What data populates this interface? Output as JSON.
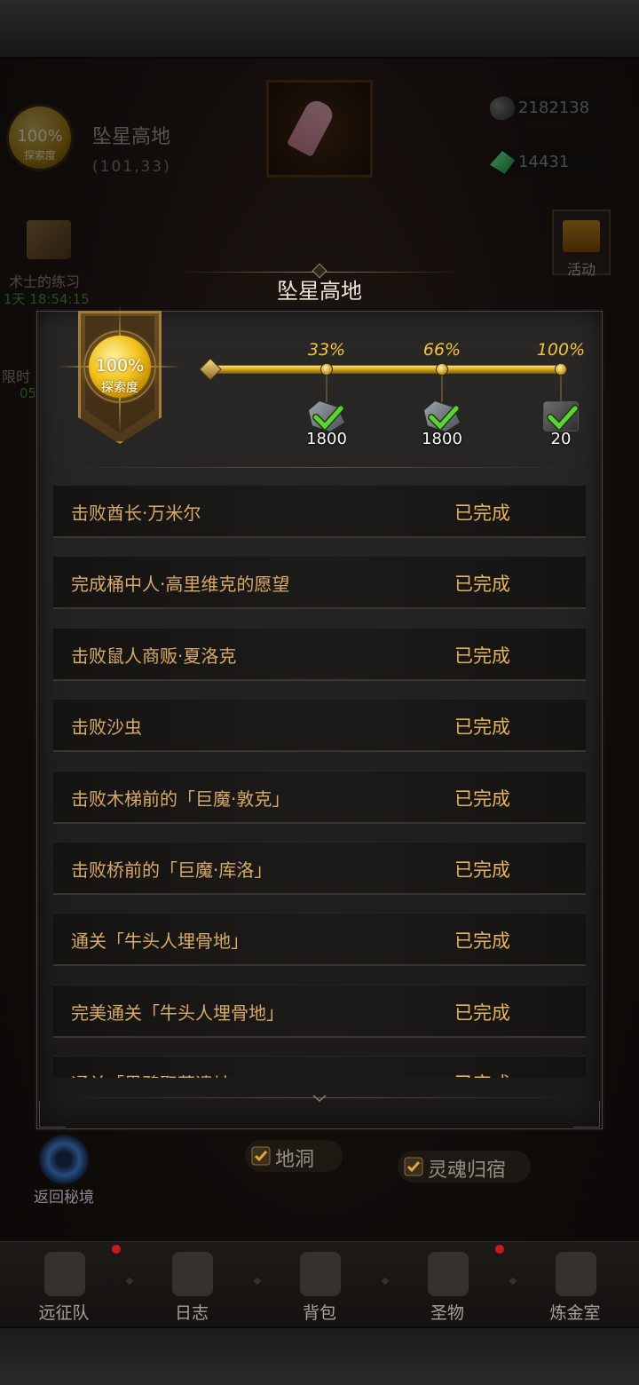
{
  "location": {
    "title": "坠星高地",
    "coords": "(101,33)",
    "badge_pct": "100%",
    "badge_label": "探索度"
  },
  "resources": {
    "stone_icon": "stone-icon",
    "stone": "2182138",
    "gem_icon": "gem-icon",
    "gem": "14431"
  },
  "side": {
    "crate_label": "术士的练习",
    "crate_timer": "1天 18:54:15",
    "limited_label": "限时",
    "limited_timer": "05",
    "gift_label": "活动"
  },
  "modal": {
    "title": "坠星高地",
    "explore_pct": "100%",
    "explore_label": "探索度",
    "progress": 1.0,
    "milestones": [
      {
        "pct": "33%",
        "reward": "crystal-icon",
        "qty": "1800",
        "claimed": true
      },
      {
        "pct": "66%",
        "reward": "crystal-icon",
        "qty": "1800",
        "claimed": true
      },
      {
        "pct": "100%",
        "reward": "ore-icon",
        "qty": "20",
        "claimed": true
      }
    ],
    "tasks": [
      {
        "name": "击败酋长·万米尔",
        "status": "已完成"
      },
      {
        "name": "完成桶中人·高里维克的愿望",
        "status": "已完成"
      },
      {
        "name": "击败鼠人商贩·夏洛克",
        "status": "已完成"
      },
      {
        "name": "击败沙虫",
        "status": "已完成"
      },
      {
        "name": "击败木梯前的「巨魔·敦克」",
        "status": "已完成"
      },
      {
        "name": "击败桥前的「巨魔·库洛」",
        "status": "已完成"
      },
      {
        "name": "通关「牛头人埋骨地」",
        "status": "已完成"
      },
      {
        "name": "完美通关「牛头人埋骨地」",
        "status": "已完成"
      },
      {
        "name": "通关「黑鸦聚落遗址」",
        "status": "已完成"
      }
    ]
  },
  "below": {
    "return_label": "返回秘境",
    "chip1": "地洞",
    "chip2": "灵魂归宿"
  },
  "nav": [
    {
      "label": "远征队",
      "icon": "helmet-icon",
      "badge": true
    },
    {
      "label": "日志",
      "icon": "journal-icon",
      "badge": false
    },
    {
      "label": "背包",
      "icon": "backpack-icon",
      "badge": false
    },
    {
      "label": "圣物",
      "icon": "relic-icon",
      "badge": true
    },
    {
      "label": "炼金室",
      "icon": "alchemy-icon",
      "badge": false
    }
  ],
  "colors": {
    "accent_gold": "#e5b25f",
    "task_text": "#d8a96a",
    "check_green": "#5fd13a"
  }
}
